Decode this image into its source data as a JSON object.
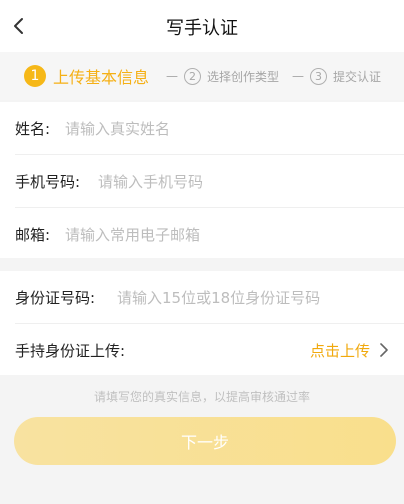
{
  "header": {
    "title": "写手认证",
    "back_icon": "chevron-left-icon"
  },
  "steps": [
    {
      "number": "1",
      "label": "上传基本信息",
      "active": true
    },
    {
      "number": "2",
      "label": "选择创作类型",
      "active": false
    },
    {
      "number": "3",
      "label": "提交认证",
      "active": false
    }
  ],
  "step_separator": "—",
  "basic_info": {
    "name": {
      "label": "姓名:",
      "placeholder": "请输入真实姓名"
    },
    "phone": {
      "label": "手机号码:",
      "placeholder": "请输入手机号码"
    },
    "email": {
      "label": "邮箱:",
      "placeholder": "请输入常用电子邮箱"
    }
  },
  "identity": {
    "id_number": {
      "label": "身份证号码:",
      "placeholder": "请输入15位或18位身份证号码"
    },
    "id_photo": {
      "label": "手持身份证上传:",
      "action": "点击上传",
      "icon": "chevron-right-icon"
    }
  },
  "tip": "请填写您的真实信息，以提高审核通过率",
  "next_button": "下一步",
  "colors": {
    "accent": "#f5b016",
    "button": "#f8e1a0",
    "placeholder": "#bdbdbd",
    "background": "#f4f4f4"
  }
}
